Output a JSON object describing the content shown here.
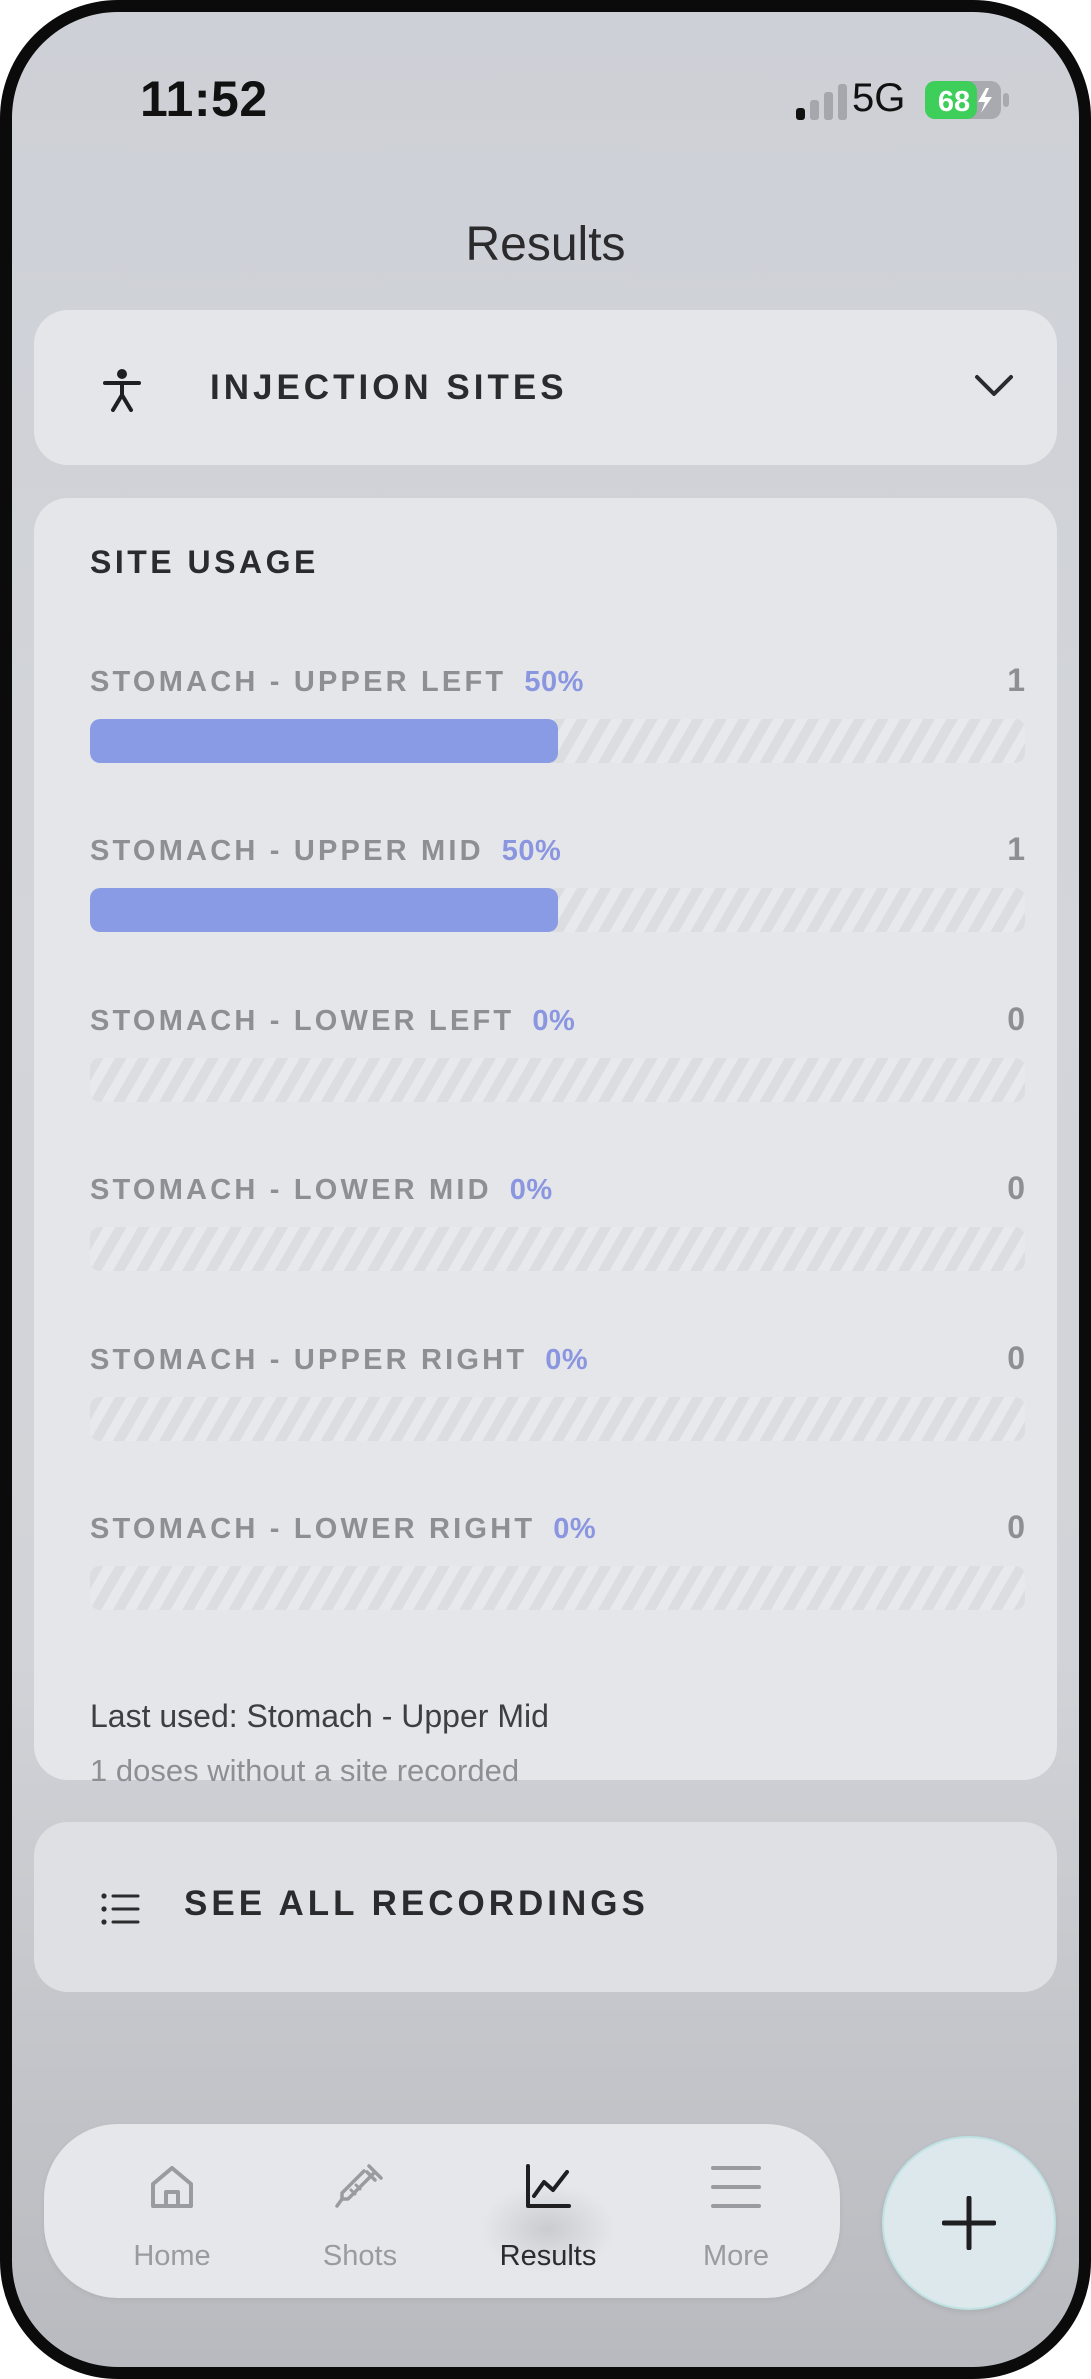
{
  "status_bar": {
    "time": "11:52",
    "network": "5G",
    "battery": "68"
  },
  "header": {
    "title": "Results"
  },
  "injection_card": {
    "label": "INJECTION SITES",
    "icon": "person-icon"
  },
  "site_usage": {
    "title": "SITE USAGE",
    "sites": [
      {
        "name": "STOMACH - UPPER LEFT",
        "percent_label": "50%",
        "fraction": 0.5,
        "count": "1"
      },
      {
        "name": "STOMACH - UPPER MID",
        "percent_label": "50%",
        "fraction": 0.5,
        "count": "1"
      },
      {
        "name": "STOMACH - LOWER LEFT",
        "percent_label": "0%",
        "fraction": 0,
        "count": "0"
      },
      {
        "name": "STOMACH - LOWER MID",
        "percent_label": "0%",
        "fraction": 0,
        "count": "0"
      },
      {
        "name": "STOMACH - UPPER RIGHT",
        "percent_label": "0%",
        "fraction": 0,
        "count": "0"
      },
      {
        "name": "STOMACH - LOWER RIGHT",
        "percent_label": "0%",
        "fraction": 0,
        "count": "0"
      }
    ],
    "last_used": "Last used: Stomach - Upper Mid",
    "no_site_note": "1 doses without a site recorded"
  },
  "recordings": {
    "label": "SEE ALL RECORDINGS",
    "icon": "list-icon"
  },
  "tabbar": {
    "tabs": [
      {
        "label": "Home",
        "icon": "home-icon"
      },
      {
        "label": "Shots",
        "icon": "syringe-icon"
      },
      {
        "label": "Results",
        "icon": "chart-icon",
        "active": true
      },
      {
        "label": "More",
        "icon": "menu-icon"
      }
    ]
  },
  "fab": {
    "icon": "plus-icon"
  },
  "colors": {
    "accent": "#8a9be6",
    "fab_border": "#bfe3e3",
    "battery": "#3ecf5a"
  }
}
